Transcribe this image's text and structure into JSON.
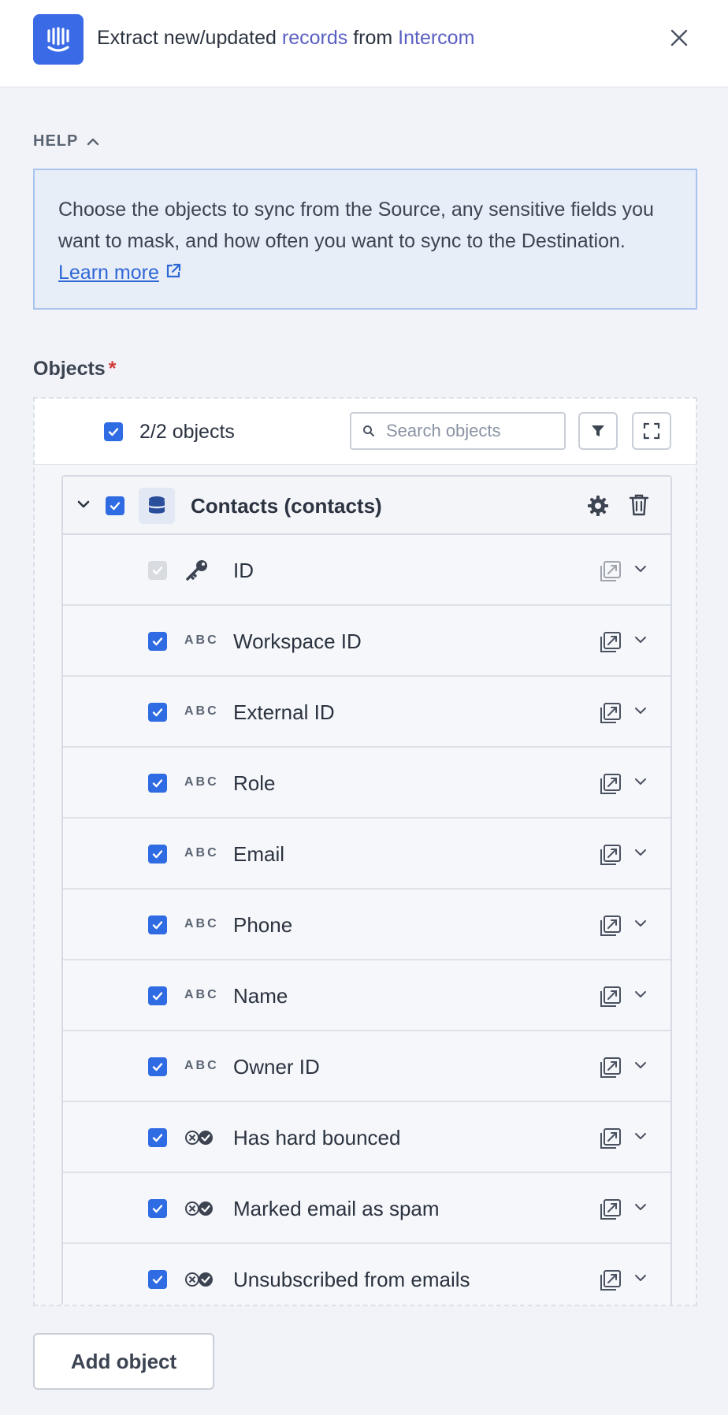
{
  "header": {
    "title_prefix": "Extract new/updated",
    "title_records": "records",
    "title_from": "from",
    "title_source": "Intercom"
  },
  "help": {
    "toggle_label": "HELP",
    "text": "Choose the objects to sync from the Source, any sensitive fields you want to mask, and how often you want to sync to the Destination.",
    "learn_more": "Learn more"
  },
  "objects": {
    "label": "Objects",
    "required_mark": "*",
    "count_label": "2/2 objects",
    "search_placeholder": "Search objects"
  },
  "group": {
    "title": "Contacts (contacts)",
    "fields": [
      {
        "name": "ID",
        "type_icon": "key-icon",
        "checked": true,
        "disabled": true
      },
      {
        "name": "Workspace ID",
        "type_icon": "ABC",
        "checked": true
      },
      {
        "name": "External ID",
        "type_icon": "ABC",
        "checked": true
      },
      {
        "name": "Role",
        "type_icon": "ABC",
        "checked": true
      },
      {
        "name": "Email",
        "type_icon": "ABC",
        "checked": true
      },
      {
        "name": "Phone",
        "type_icon": "ABC",
        "checked": true
      },
      {
        "name": "Name",
        "type_icon": "ABC",
        "checked": true
      },
      {
        "name": "Owner ID",
        "type_icon": "ABC",
        "checked": true
      },
      {
        "name": "Has hard bounced",
        "type_icon": "boolean-icon",
        "checked": true
      },
      {
        "name": "Marked email as spam",
        "type_icon": "boolean-icon",
        "checked": true
      },
      {
        "name": "Unsubscribed from emails",
        "type_icon": "boolean-icon",
        "checked": true
      }
    ]
  },
  "footer": {
    "add_object_label": "Add object"
  },
  "colors": {
    "accent": "#2f6be2",
    "brand": "#3a6ae6",
    "link": "#5a5fc2"
  }
}
